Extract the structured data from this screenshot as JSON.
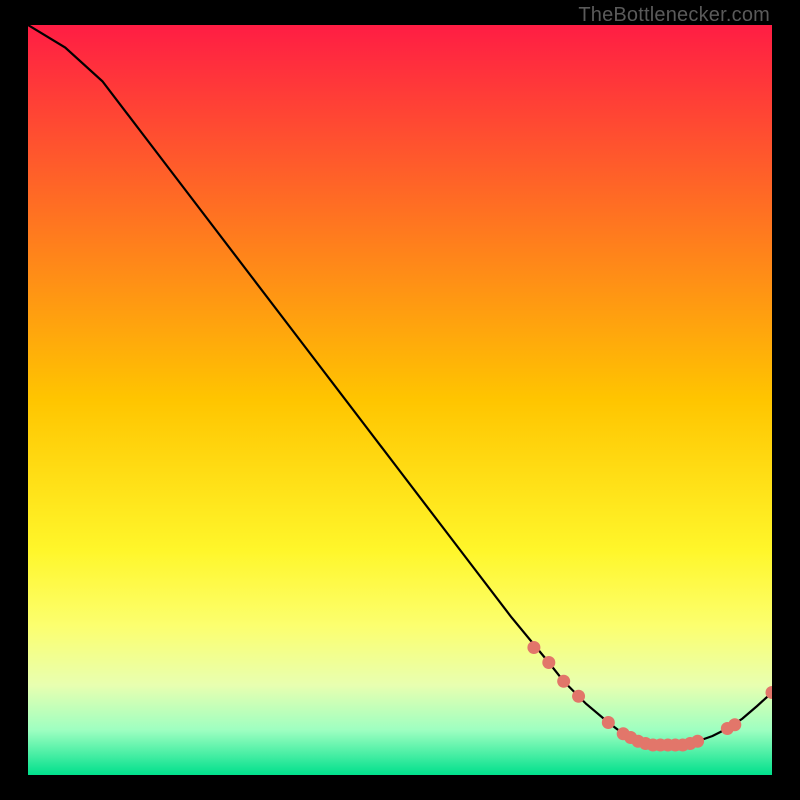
{
  "watermark": "TheBottlenecker.com",
  "chart_data": {
    "type": "line",
    "title": "",
    "xlabel": "",
    "ylabel": "",
    "xlim": [
      0,
      100
    ],
    "ylim": [
      0,
      100
    ],
    "curve": {
      "x": [
        0,
        5,
        10,
        15,
        20,
        25,
        30,
        35,
        40,
        45,
        50,
        55,
        60,
        65,
        70,
        72,
        75,
        78,
        80,
        82,
        84,
        86,
        88,
        90,
        92,
        94,
        96,
        98,
        100
      ],
      "y": [
        100,
        97,
        92.5,
        86,
        79.5,
        73,
        66.5,
        60,
        53.5,
        47,
        40.5,
        34,
        27.5,
        21,
        15,
        12.5,
        9.5,
        7,
        5.5,
        4.5,
        4,
        4,
        4,
        4.5,
        5.2,
        6.2,
        7.5,
        9.2,
        11
      ]
    },
    "markers": {
      "x": [
        68,
        70,
        72,
        74,
        78,
        80,
        81,
        82,
        83,
        84,
        85,
        86,
        87,
        88,
        89,
        90,
        94,
        95,
        100
      ],
      "y": [
        17,
        15,
        12.5,
        10.5,
        7,
        5.5,
        5,
        4.5,
        4.2,
        4,
        4,
        4,
        4,
        4,
        4.2,
        4.5,
        6.2,
        6.7,
        11
      ]
    },
    "gradient_stops": [
      {
        "offset": 0.0,
        "color": "#ff1d44"
      },
      {
        "offset": 0.5,
        "color": "#ffc500"
      },
      {
        "offset": 0.7,
        "color": "#fff62a"
      },
      {
        "offset": 0.8,
        "color": "#fcff6e"
      },
      {
        "offset": 0.88,
        "color": "#e8ffb0"
      },
      {
        "offset": 0.94,
        "color": "#9effc1"
      },
      {
        "offset": 1.0,
        "color": "#00e08c"
      }
    ],
    "marker_color": "#e2766a",
    "curve_color": "#000000"
  }
}
